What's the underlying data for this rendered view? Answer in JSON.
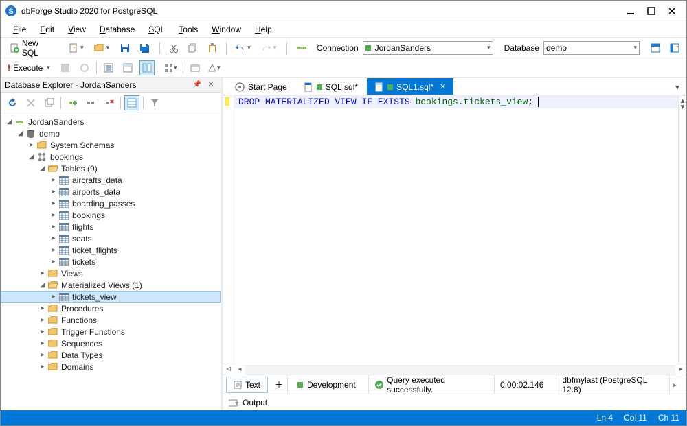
{
  "app": {
    "title": "dbForge Studio 2020 for PostgreSQL"
  },
  "menu": [
    "File",
    "Edit",
    "View",
    "Database",
    "SQL",
    "Tools",
    "Window",
    "Help"
  ],
  "menu_accel": [
    "F",
    "E",
    "V",
    "D",
    "S",
    "T",
    "W",
    "H"
  ],
  "tb1": {
    "new_sql": "New SQL",
    "connection_label": "Connection",
    "connection_value": "JordanSanders",
    "database_label": "Database",
    "database_value": "demo"
  },
  "tb2": {
    "execute": "Execute"
  },
  "explorer": {
    "panel_title": "Database Explorer - JordanSanders",
    "server": "JordanSanders",
    "db": "demo",
    "schemas_folder": "System Schemas",
    "schema": "bookings",
    "tables_folder": "Tables (9)",
    "tables": [
      "aircrafts_data",
      "airports_data",
      "boarding_passes",
      "bookings",
      "flights",
      "seats",
      "ticket_flights",
      "tickets"
    ],
    "views_folder": "Views",
    "mviews_folder": "Materialized Views (1)",
    "mview_item": "tickets_view",
    "procs": "Procedures",
    "funcs": "Functions",
    "trigf": "Trigger Functions",
    "seqs": "Sequences",
    "dtypes": "Data Types",
    "domains": "Domains"
  },
  "output": {
    "label": "Output"
  },
  "tabs": {
    "start": "Start Page",
    "sql1": "SQL.sql*",
    "sql2": "SQL1.sql*"
  },
  "code": {
    "kw1": "DROP MATERIALIZED VIEW IF EXISTS ",
    "ident": "bookings.tickets_view",
    "semi": ";"
  },
  "bottom": {
    "text_tab": "Text",
    "env": "Development",
    "status": "Query executed successfully.",
    "time": "0:00:02.146",
    "server": "dbfmylast (PostgreSQL 12.8)"
  },
  "footer": {
    "ln": "Ln 4",
    "col": "Col 11",
    "ch": "Ch 11"
  }
}
